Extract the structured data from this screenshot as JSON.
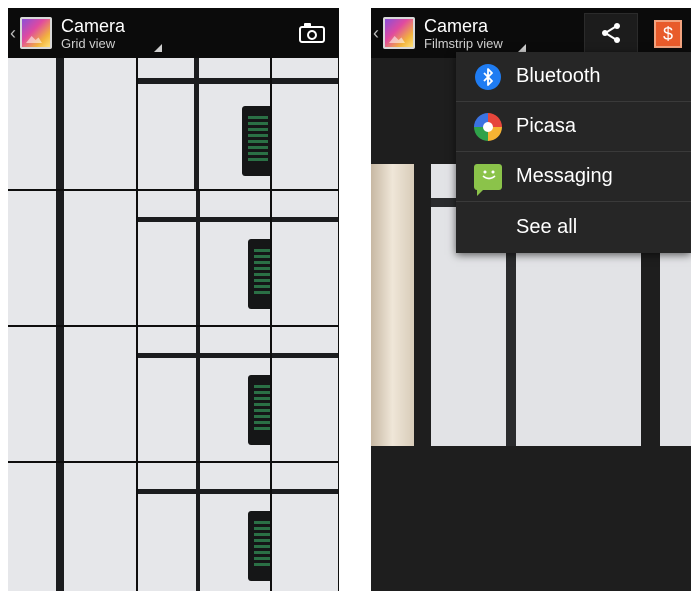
{
  "left_screen": {
    "title": "Camera",
    "subtitle": "Grid view",
    "icons": {
      "back": "chevron-left-icon",
      "app": "gallery-icon",
      "camera": "camera-icon"
    }
  },
  "right_screen": {
    "title": "Camera",
    "subtitle": "Filmstrip view",
    "icons": {
      "back": "chevron-left-icon",
      "app": "gallery-icon",
      "share": "share-icon",
      "qr": "qr-scanner-icon"
    },
    "share_menu": [
      {
        "label": "Bluetooth",
        "icon": "bluetooth-icon"
      },
      {
        "label": "Picasa",
        "icon": "picasa-icon"
      },
      {
        "label": "Messaging",
        "icon": "messaging-icon"
      },
      {
        "label": "See all",
        "icon": ""
      }
    ]
  },
  "colors": {
    "actionbar": "#0b0b0b",
    "popup": "#262626",
    "bluetooth": "#1f7cf2",
    "messaging": "#8bc34a"
  }
}
